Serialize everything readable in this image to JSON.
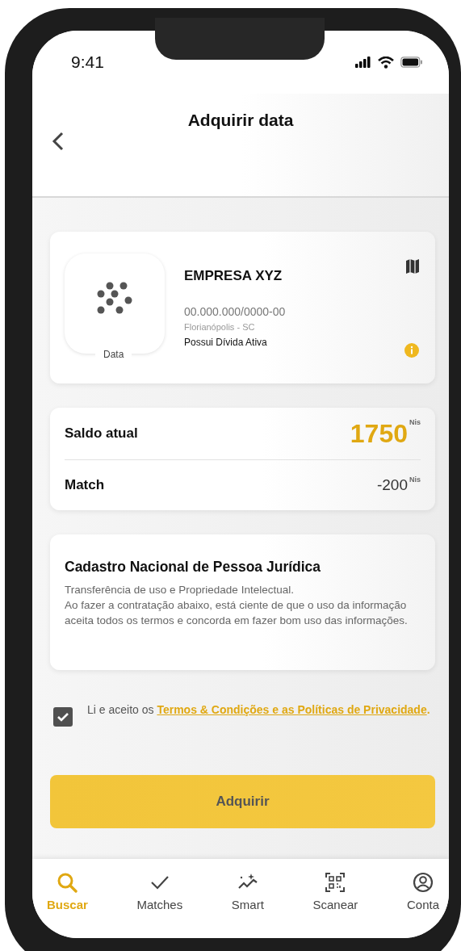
{
  "status_bar": {
    "time": "9:41"
  },
  "header": {
    "title": "Adquirir data"
  },
  "company": {
    "logo_label": "Data",
    "name": "EMPRESA XYZ",
    "cnpj": "00.000.000/0000-00",
    "location": "Florianópolis - SC",
    "status": "Possui Dívida Ativa"
  },
  "balance": [
    {
      "label": "Saldo atual",
      "value": "1750",
      "unit": "Nis",
      "kind": "highlight"
    },
    {
      "label": "Match",
      "value": "-200",
      "unit": "Nis",
      "kind": "plain"
    }
  ],
  "info": {
    "title": "Cadastro Nacional de Pessoa Jurídica",
    "paragraphs": [
      "Transferência de uso e Propriedade Intelectual.",
      "Ao fazer a contratação abaixo, está ciente de que o uso da informação aceita todos os termos e concorda em fazer bom uso das informações."
    ]
  },
  "terms": {
    "checked": true,
    "text": "Li e aceito os",
    "link": "Termos & Condições e as Políticas de Privacidade",
    "suffix": "."
  },
  "button": {
    "label": "Adquirir"
  },
  "nav": [
    {
      "label": "Buscar",
      "kind": "search",
      "selected": true
    },
    {
      "label": "Matches",
      "kind": "check",
      "selected": false
    },
    {
      "label": "Smart",
      "kind": "sparkle",
      "selected": false
    },
    {
      "label": "Scanear",
      "kind": "scan",
      "selected": false
    },
    {
      "label": "Conta",
      "kind": "account",
      "selected": false
    }
  ]
}
